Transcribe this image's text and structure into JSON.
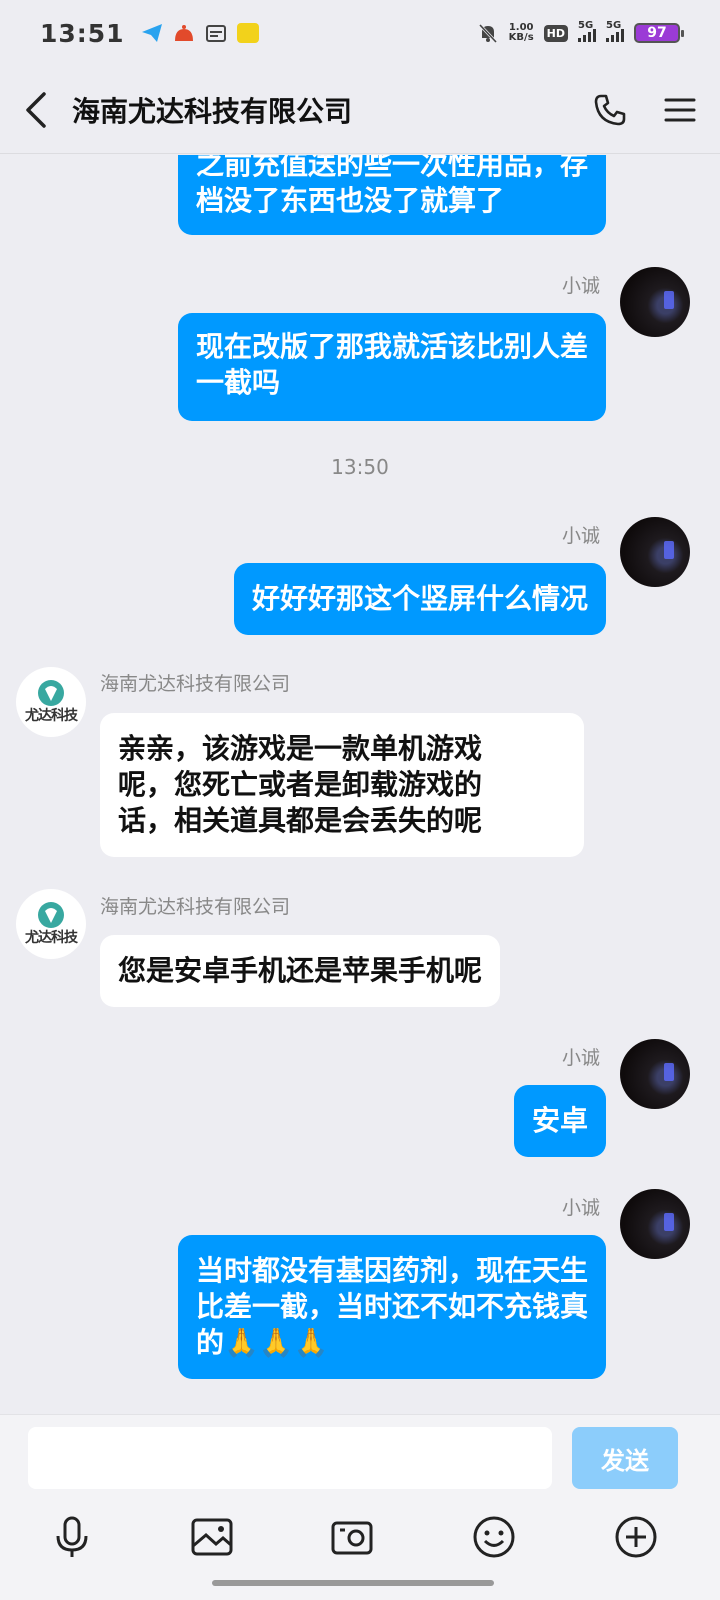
{
  "status_bar": {
    "time": "13:51",
    "net_speed_value": "1.00",
    "net_speed_unit": "KB/s",
    "hd_label": "HD",
    "sim1_label": "5G",
    "sim2_label": "5G",
    "battery": "97"
  },
  "header": {
    "title": "海南尤达科技有限公司"
  },
  "messages": {
    "m1_line1": "之前充值送的些一次性用品，存",
    "m1_line2": "档没了东西也没了就算了",
    "m2_sender": "小诚",
    "m2_line1": "现在改版了那我就活该比别人差",
    "m2_line2": "一截吗",
    "timestamp": "13:50",
    "m3_sender": "小诚",
    "m3_text": "好好好那这个竖屏什么情况",
    "m4_sender": "海南尤达科技有限公司",
    "m4_line1": "亲亲，该游戏是一款单机游戏",
    "m4_line2": "呢，您死亡或者是卸载游戏的",
    "m4_line3": "话，相关道具都是会丢失的呢",
    "m5_sender": "海南尤达科技有限公司",
    "m5_text": "您是安卓手机还是苹果手机呢",
    "m6_sender": "小诚",
    "m6_text": "安卓",
    "m7_sender": "小诚",
    "m7_line1": "当时都没有基因药剂，现在天生",
    "m7_line2": "比差一截，当时还不如不充钱真",
    "m7_line3": "的🙏🙏🙏"
  },
  "company_avatar_text": "尤达科技",
  "input": {
    "placeholder": "",
    "send_label": "发送"
  },
  "toolbar_icons": [
    "microphone-icon",
    "image-icon",
    "camera-icon",
    "emoji-icon",
    "plus-icon"
  ],
  "colors": {
    "outgoing_bubble": "#0099ff",
    "incoming_bubble": "#ffffff",
    "send_button": "#8ccdfb",
    "background": "#ededf2"
  }
}
